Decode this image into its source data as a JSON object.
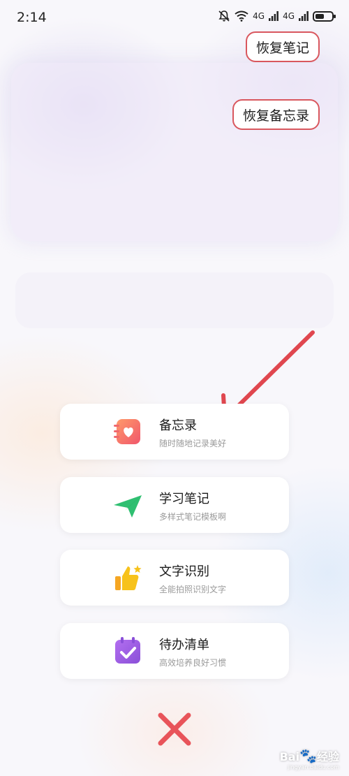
{
  "status_bar": {
    "time": "2:14",
    "signal_1": "4G",
    "signal_2": "4G"
  },
  "restore_notes_label": "恢复笔记",
  "restore_memo_label": "恢复备忘录",
  "options": [
    {
      "title": "备忘录",
      "subtitle": "随时随地记录美好",
      "icon": "memo-heart-icon",
      "color": "#f0686e"
    },
    {
      "title": "学习笔记",
      "subtitle": "多样式笔记模板啊",
      "icon": "paper-plane-icon",
      "color": "#2fbf71"
    },
    {
      "title": "文字识别",
      "subtitle": "全能拍照识别文字",
      "icon": "thumbs-up-icon",
      "color": "#f7c21b"
    },
    {
      "title": "待办清单",
      "subtitle": "高效培养良好习惯",
      "icon": "calendar-check-icon",
      "color": "#9a5de0"
    }
  ],
  "annotation_color": "#e0474f",
  "watermark": {
    "brand": "Bai",
    "brand_suffix": "经验",
    "url": "jingyan.baidu.com"
  }
}
